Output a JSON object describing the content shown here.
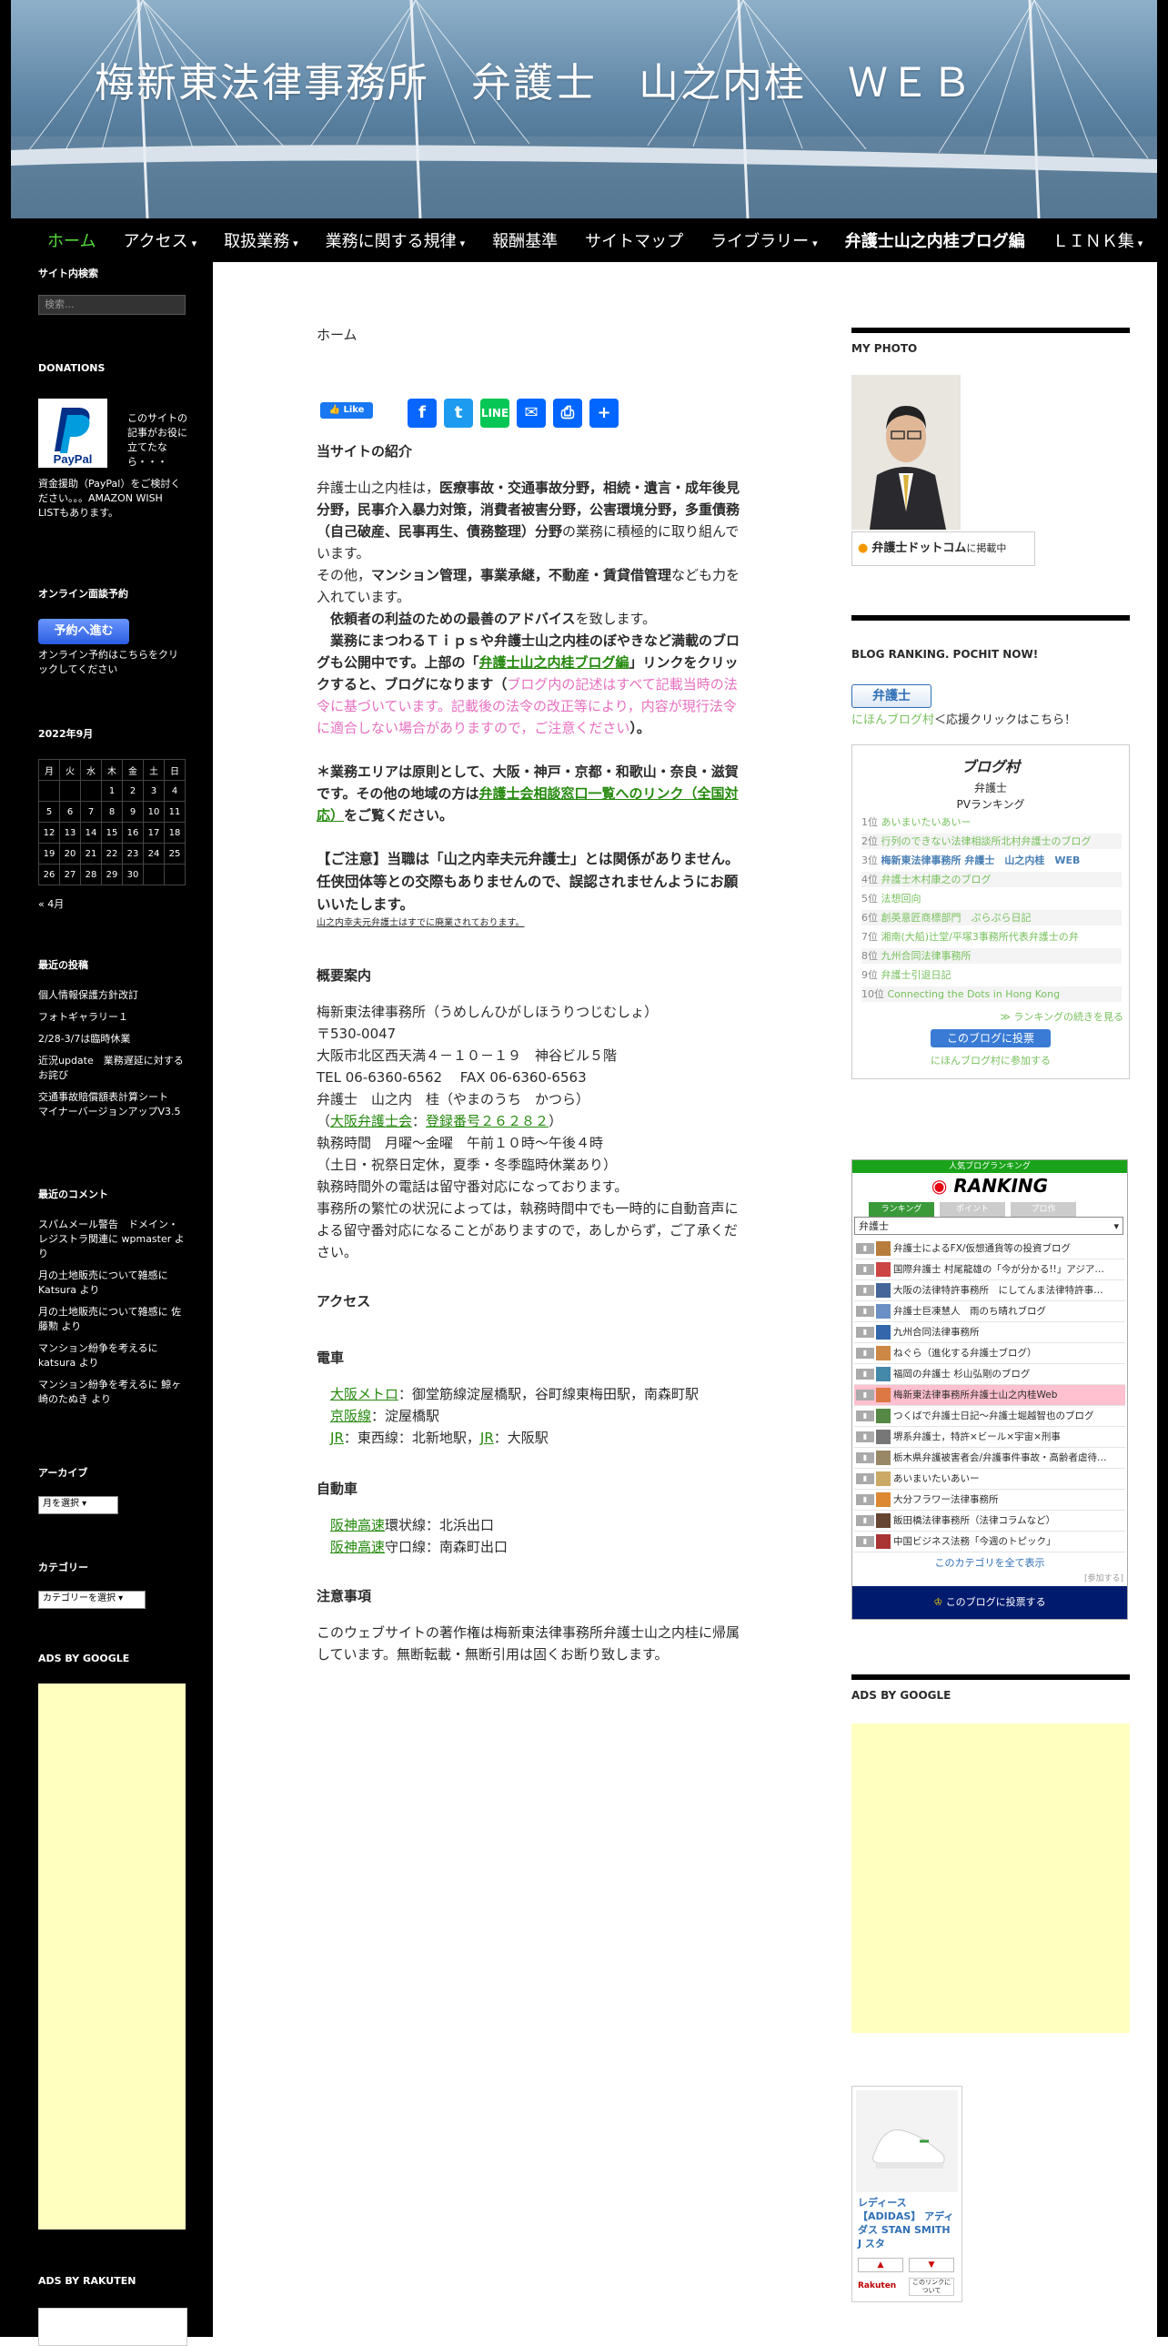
{
  "header": {
    "site_title": "梅新東法律事務所　弁護士　山之内桂　ＷＥＢ"
  },
  "nav": {
    "items": [
      {
        "label": "ホーム",
        "dropdown": false
      },
      {
        "label": "アクセス",
        "dropdown": true
      },
      {
        "label": "取扱業務",
        "dropdown": true
      },
      {
        "label": "業務に関する規律",
        "dropdown": true
      },
      {
        "label": "報酬基準",
        "dropdown": false
      },
      {
        "label": "サイトマップ",
        "dropdown": false
      },
      {
        "label": "ライブラリー",
        "dropdown": true
      },
      {
        "label": "弁護士山之内桂ブログ編",
        "dropdown": false
      },
      {
        "label": "ＬＩＮＫ集",
        "dropdown": true
      }
    ]
  },
  "left_sidebar": {
    "search_title": "サイト内検索",
    "search_placeholder": "検索...",
    "donations_title": "DONATIONS",
    "paypal_logo": "PayPal",
    "donations_text_1": "このサイトの記事がお役に立てたなら・・・",
    "donations_text_2": "資金援助（PayPal）をご検討ください。。。AMAZON WISH LISTもあります。",
    "booking_title": "オンライン面談予約",
    "booking_button": "予約へ進む",
    "booking_text": "オンライン予約はこちらをクリックしてください",
    "calendar": {
      "caption": "2022年9月",
      "weekdays": [
        "月",
        "火",
        "水",
        "木",
        "金",
        "土",
        "日"
      ],
      "weeks": [
        [
          "",
          "",
          "",
          "1",
          "2",
          "3",
          "4"
        ],
        [
          "5",
          "6",
          "7",
          "8",
          "9",
          "10",
          "11"
        ],
        [
          "12",
          "13",
          "14",
          "15",
          "16",
          "17",
          "18"
        ],
        [
          "19",
          "20",
          "21",
          "22",
          "23",
          "24",
          "25"
        ],
        [
          "26",
          "27",
          "28",
          "29",
          "30",
          "",
          ""
        ]
      ],
      "prev": "« 4月"
    },
    "recent_posts_title": "最近の投稿",
    "recent_posts": [
      "個人情報保護方針改訂",
      "フォトギャラリー１",
      "2/28-3/7は臨時休業",
      "近況update　業務遅延に対するお詫び",
      "交通事故賠償額表計算シート　マイナーバージョンアップV3.5"
    ],
    "recent_comments_title": "最近のコメント",
    "recent_comments": [
      "スパムメール警告　ドメイン・レジストラ関連に wpmaster より",
      "月の土地販売について雑感に Katsura より",
      "月の土地販売について雑感に 佐藤勲 より",
      "マンション紛争を考えるに katsura より",
      "マンション紛争を考えるに 鯨ヶ崎のたぬき より"
    ],
    "archives_title": "アーカイブ",
    "archives_select": "月を選択",
    "categories_title": "カテゴリー",
    "categories_select": "カテゴリーを選択",
    "ads_google_title": "ADS BY GOOGLE",
    "ads_rakuten_title": "ADS BY RAKUTEN"
  },
  "main": {
    "page_title": "ホーム",
    "fb_like": "Like",
    "share_icons": [
      "facebook-icon",
      "twitter-icon",
      "line-icon",
      "email-icon",
      "print-icon",
      "share-icon"
    ],
    "intro_heading": "当サイトの紹介",
    "intro_p1_a": "弁護士山之内桂は，",
    "intro_p1_b": "医療事故・交通事故分野，相続・遺言・成年後見分野，民事介入暴力対策，消費者被害分野，公害環境分野，多重債務（自己破産、民事再生、債務整理）分野",
    "intro_p1_c": "の業務に積極的に取り組んでいます。",
    "intro_p2_a": "その他，",
    "intro_p2_b": "マンション管理，事業承継，不動産・賃貸借管理",
    "intro_p2_c": "なども力を入れています。",
    "intro_p3_a": "依頼者の利益のための最善のアドバイス",
    "intro_p3_b": "を致します。",
    "intro_p4_a": "業務にまつわるＴｉｐｓや弁護士山之内桂のぼやきなど満載のブログも公開中です。上部の「",
    "intro_p4_link": "弁護士山之内桂ブログ編",
    "intro_p4_b": "」リンクをクリックすると、ブログになります（",
    "intro_p4_pink": "ブログ内の記述はすべて記載当時の法令に基づいています。記載後の法令の改正等により，内容が現行法令に適合しない場合がありますので，ご注意ください",
    "intro_p4_c": "）。",
    "intro_p5_a": "＊業務エリアは原則として、大阪・神戸・京都・和歌山・奈良・滋賀です。その他の地域の方は",
    "intro_p5_link": "弁護士会相談窓口一覧へのリンク（全国対応）",
    "intro_p5_b": "をご覧ください。",
    "notice_pink": "【ご注意】当職は「山之内幸夫元弁護士」とは関係がありません。任侠団体等との交際もありませんので、誤認されませんようにお願いいたします。",
    "notice_small_link": "山之内幸夫元弁護士はすでに廃業されております。",
    "overview_heading": "概要案内",
    "overview_lines": [
      "梅新東法律事務所（うめしんひがしほうりつじむしょ）",
      "〒530-0047",
      "大阪市北区西天満４－１０－１９　神谷ビル５階",
      "TEL 06-6360-6562　 FAX 06-6360-6563",
      "弁護士　山之内　桂（やまのうち　かつら）"
    ],
    "registration_a": "（",
    "registration_link1": "大阪弁護士会",
    "registration_sep": "：",
    "registration_link2": "登録番号２６２８２",
    "registration_b": "）",
    "overview_lines2": [
      "執務時間　月曜～金曜　午前１０時～午後４時",
      "（土日・祝祭日定休，夏季・冬季臨時休業あり）",
      "執務時間外の電話は留守番対応になっております。",
      "事務所の繁忙の状況によっては，執務時間中でも一時的に自動音声による留守番対応になることがありますので，あしからず，ご了承ください。"
    ],
    "access_heading": "アクセス",
    "train_heading": "電車",
    "train_1_link": "大阪メトロ",
    "train_1_text": "：御堂筋線淀屋橋駅，谷町線東梅田駅，南森町駅",
    "train_2_link": "京阪線",
    "train_2_text": "：淀屋橋駅",
    "train_3_link": "JR",
    "train_3_text": "：東西線：北新地駅，",
    "train_3_link2": "JR",
    "train_3_text2": "：大阪駅",
    "car_heading": "自動車",
    "car_1_link": "阪神高速",
    "car_1_text": "環状線：北浜出口",
    "car_2_link": "阪神高速",
    "car_2_text": "守口線：南森町出口",
    "caution_heading": "注意事項",
    "caution_text": "このウェブサイトの著作権は梅新東法律事務所弁護士山之内桂に帰属しています。無断転載・無断引用は固くお断り致します。"
  },
  "right_sidebar": {
    "photo_title": "MY PHOTO",
    "bengo_badge": "弁護士ドットコム",
    "bengo_badge_suffix": "に掲載中",
    "blog_ranking_title": "BLOG RANKING. POCHIT NOW!",
    "mura_badge": "弁護士",
    "mura_link": "にほんブログ村",
    "mura_text": "＜応援クリックはこちら！",
    "mura_logo": "ブログ村",
    "mura_cat": "弁護士",
    "mura_pv": "PVランキング",
    "mura_rows": [
      {
        "rank": "1位",
        "title": "あいまいたいあいー"
      },
      {
        "rank": "2位",
        "title": "行列のできない法律相談所北村弁護士のブログ"
      },
      {
        "rank": "3位",
        "title": "梅新東法律事務所 弁護士　山之内桂　WEB"
      },
      {
        "rank": "4位",
        "title": "弁護士木村康之のブログ"
      },
      {
        "rank": "5位",
        "title": "法想回向"
      },
      {
        "rank": "6位",
        "title": "創英意匠商標部門　ぷらぷら日記"
      },
      {
        "rank": "7位",
        "title": "湘南(大船)辻堂/平塚3事務所代表弁護士の弁"
      },
      {
        "rank": "8位",
        "title": "九州合同法律事務所"
      },
      {
        "rank": "9位",
        "title": "弁護士引退日記"
      },
      {
        "rank": "10位",
        "title": "Connecting the Dots in Hong Kong"
      }
    ],
    "mura_more": "≫ ランキングの続きを見る",
    "mura_vote": "このブログに投票",
    "mura_join": "にほんブログ村に参加する",
    "ranking2_header": "人気ブログランキング",
    "ranking2_logo": "RANKING",
    "ranking2_tabs": [
      "ランキング",
      "ポイント",
      "プロ作"
    ],
    "ranking2_select": "弁護士",
    "ranking2_rows": [
      "弁護士によるFX/仮想通貨等の投資ブログ",
      "国際弁護士 村尾龍雄の「今が分かる!!」アジア…",
      "大阪の法律特許事務所　にしてんま法律特許事…",
      "弁護士巨凍慧人　雨のち晴れブログ",
      "九州合同法律事務所",
      "ねぐら（進化する弁護士ブログ）",
      "福岡の弁護士 杉山弘剛のブログ",
      "梅新東法律事務所弁護士山之内桂Web",
      "つくばで弁護士日記～弁護士堀越智也のブログ",
      "堺系弁護士，特許×ビール×宇宙×刑事",
      "栃木県弁護被害者会/弁護事件事故・高齢者虐待…",
      "あいまいたいあいー",
      "大分フラワー法律事務所",
      "飯田橋法律事務所（法律コラムなど）",
      "中国ビジネス法務「今週のトピック」"
    ],
    "ranking2_all": "このカテゴリを全て表示",
    "ranking2_join": "[参加する]",
    "ranking2_vote": "このブログに投票する",
    "ads_google_title": "ADS BY GOOGLE",
    "rakuten_item": "レディース 【ADIDAS】 アディダス STAN SMITH J スタ",
    "rakuten_logo": "Rakuten",
    "rakuten_note": "このリンクについて"
  },
  "colors": {
    "accent_green": "#24890d",
    "nav_active": "#55d737",
    "notice_pink": "#e76fc1",
    "ad_yellow": "#ffffc0"
  }
}
